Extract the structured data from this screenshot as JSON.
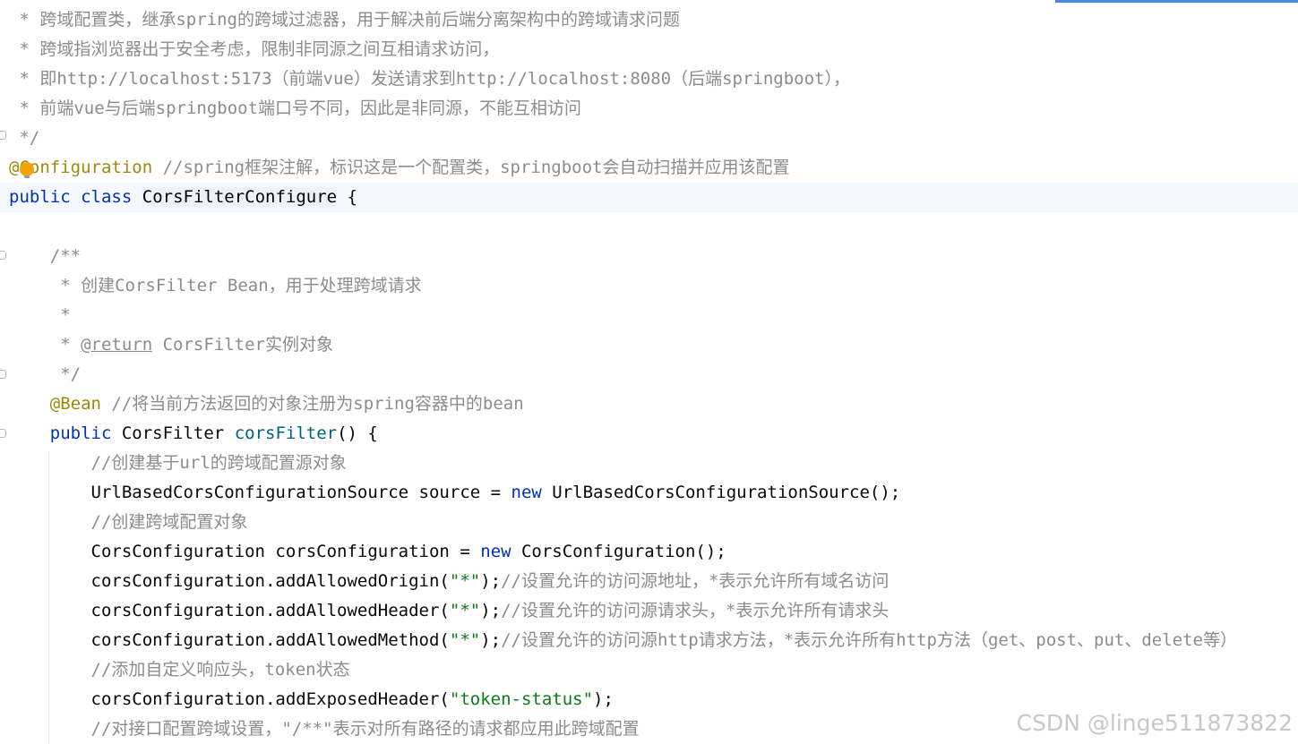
{
  "editor": {
    "lines": [
      {
        "caret": false,
        "tokens": [
          {
            "t": " * 跨域配置类，继承spring的跨域过滤器，用于解决前后端分离架构中的跨域请求问题",
            "c": "t-comment"
          }
        ]
      },
      {
        "caret": false,
        "tokens": [
          {
            "t": " * 跨域指浏览器出于安全考虑，限制非同源之间互相请求访问，",
            "c": "t-comment"
          }
        ]
      },
      {
        "caret": false,
        "tokens": [
          {
            "t": " * 即http://localhost:5173（前端vue）发送请求到http://localhost:8080（后端springboot），",
            "c": "t-comment"
          }
        ]
      },
      {
        "caret": false,
        "tokens": [
          {
            "t": " * 前端vue与后端springboot端口号不同，因此是非同源，不能互相访问",
            "c": "t-comment"
          }
        ]
      },
      {
        "caret": false,
        "tokens": [
          {
            "t": " */",
            "c": "t-comment"
          }
        ]
      },
      {
        "caret": false,
        "tokens": [
          {
            "t": "@Configuration",
            "c": "t-ann"
          },
          {
            "t": " //spring框架注解，标识这是一个配置类，springboot会自动扫描并应用该配置",
            "c": "t-comment"
          }
        ]
      },
      {
        "caret": true,
        "tokens": [
          {
            "t": "public",
            "c": "t-kw"
          },
          {
            "t": " ",
            "c": "t-plain"
          },
          {
            "t": "class",
            "c": "t-kw"
          },
          {
            "t": " ",
            "c": "t-plain"
          },
          {
            "t": "CorsFilterConfigure",
            "c": "t-class highlight-class"
          },
          {
            "t": " {",
            "c": "t-plain"
          }
        ]
      },
      {
        "caret": false,
        "tokens": []
      },
      {
        "caret": false,
        "tokens": [
          {
            "t": "    /**",
            "c": "t-comment"
          }
        ]
      },
      {
        "caret": false,
        "tokens": [
          {
            "t": "     * 创建CorsFilter Bean，用于处理跨域请求",
            "c": "t-comment"
          }
        ]
      },
      {
        "caret": false,
        "tokens": [
          {
            "t": "     *",
            "c": "t-comment"
          }
        ]
      },
      {
        "caret": false,
        "tokens": [
          {
            "t": "     * ",
            "c": "t-comment"
          },
          {
            "t": "@return",
            "c": "t-doctag"
          },
          {
            "t": " CorsFilter实例对象",
            "c": "t-comment"
          }
        ]
      },
      {
        "caret": false,
        "tokens": [
          {
            "t": "     */",
            "c": "t-comment"
          }
        ]
      },
      {
        "caret": false,
        "tokens": [
          {
            "t": "    ",
            "c": "t-plain"
          },
          {
            "t": "@Bean",
            "c": "t-ann"
          },
          {
            "t": " //将当前方法返回的对象注册为spring容器中的bean",
            "c": "t-comment"
          }
        ]
      },
      {
        "caret": false,
        "tokens": [
          {
            "t": "    ",
            "c": "t-plain"
          },
          {
            "t": "public",
            "c": "t-kw"
          },
          {
            "t": " CorsFilter ",
            "c": "t-plain"
          },
          {
            "t": "corsFilter",
            "c": "t-method"
          },
          {
            "t": "() {",
            "c": "t-plain"
          }
        ]
      },
      {
        "caret": false,
        "tokens": [
          {
            "t": "        //创建基于url的跨域配置源对象",
            "c": "t-comment"
          }
        ]
      },
      {
        "caret": false,
        "tokens": [
          {
            "t": "        UrlBasedCorsConfigurationSource source = ",
            "c": "t-plain"
          },
          {
            "t": "new",
            "c": "t-kw"
          },
          {
            "t": " UrlBasedCorsConfigurationSource();",
            "c": "t-plain"
          }
        ]
      },
      {
        "caret": false,
        "tokens": [
          {
            "t": "        //创建跨域配置对象",
            "c": "t-comment"
          }
        ]
      },
      {
        "caret": false,
        "tokens": [
          {
            "t": "        CorsConfiguration corsConfiguration = ",
            "c": "t-plain"
          },
          {
            "t": "new",
            "c": "t-kw"
          },
          {
            "t": " CorsConfiguration();",
            "c": "t-plain"
          }
        ]
      },
      {
        "caret": false,
        "tokens": [
          {
            "t": "        corsConfiguration.addAllowedOrigin(",
            "c": "t-plain"
          },
          {
            "t": "\"*\"",
            "c": "t-str"
          },
          {
            "t": ");",
            "c": "t-plain"
          },
          {
            "t": "//设置允许的访问源地址，*表示允许所有域名访问",
            "c": "t-comment"
          }
        ]
      },
      {
        "caret": false,
        "tokens": [
          {
            "t": "        corsConfiguration.addAllowedHeader(",
            "c": "t-plain"
          },
          {
            "t": "\"*\"",
            "c": "t-str"
          },
          {
            "t": ");",
            "c": "t-plain"
          },
          {
            "t": "//设置允许的访问源请求头，*表示允许所有请求头",
            "c": "t-comment"
          }
        ]
      },
      {
        "caret": false,
        "tokens": [
          {
            "t": "        corsConfiguration.addAllowedMethod(",
            "c": "t-plain"
          },
          {
            "t": "\"*\"",
            "c": "t-str"
          },
          {
            "t": ");",
            "c": "t-plain"
          },
          {
            "t": "//设置允许的访问源http请求方法，*表示允许所有http方法（get、post、put、delete等）",
            "c": "t-comment"
          }
        ]
      },
      {
        "caret": false,
        "tokens": [
          {
            "t": "        //添加自定义响应头，token状态",
            "c": "t-comment"
          }
        ]
      },
      {
        "caret": false,
        "tokens": [
          {
            "t": "        corsConfiguration.addExposedHeader(",
            "c": "t-plain"
          },
          {
            "t": "\"token-status\"",
            "c": "t-str"
          },
          {
            "t": ");",
            "c": "t-plain"
          }
        ]
      },
      {
        "caret": false,
        "tokens": [
          {
            "t": "        //对接口配置跨域设置，\"/**\"表示对所有路径的请求都应用此跨域配置",
            "c": "t-comment"
          }
        ]
      }
    ]
  },
  "watermark": {
    "text": "CSDN @linge511873822"
  },
  "icons": {
    "intention": "lightbulb-icon",
    "fold": "fold-marker-icon"
  },
  "colors": {
    "keyword": "#0033b3",
    "annotation": "#9e880d",
    "string": "#067d17",
    "comment": "#8c8c8c",
    "method": "#00627a",
    "caret_row": "#f5f8fe"
  }
}
